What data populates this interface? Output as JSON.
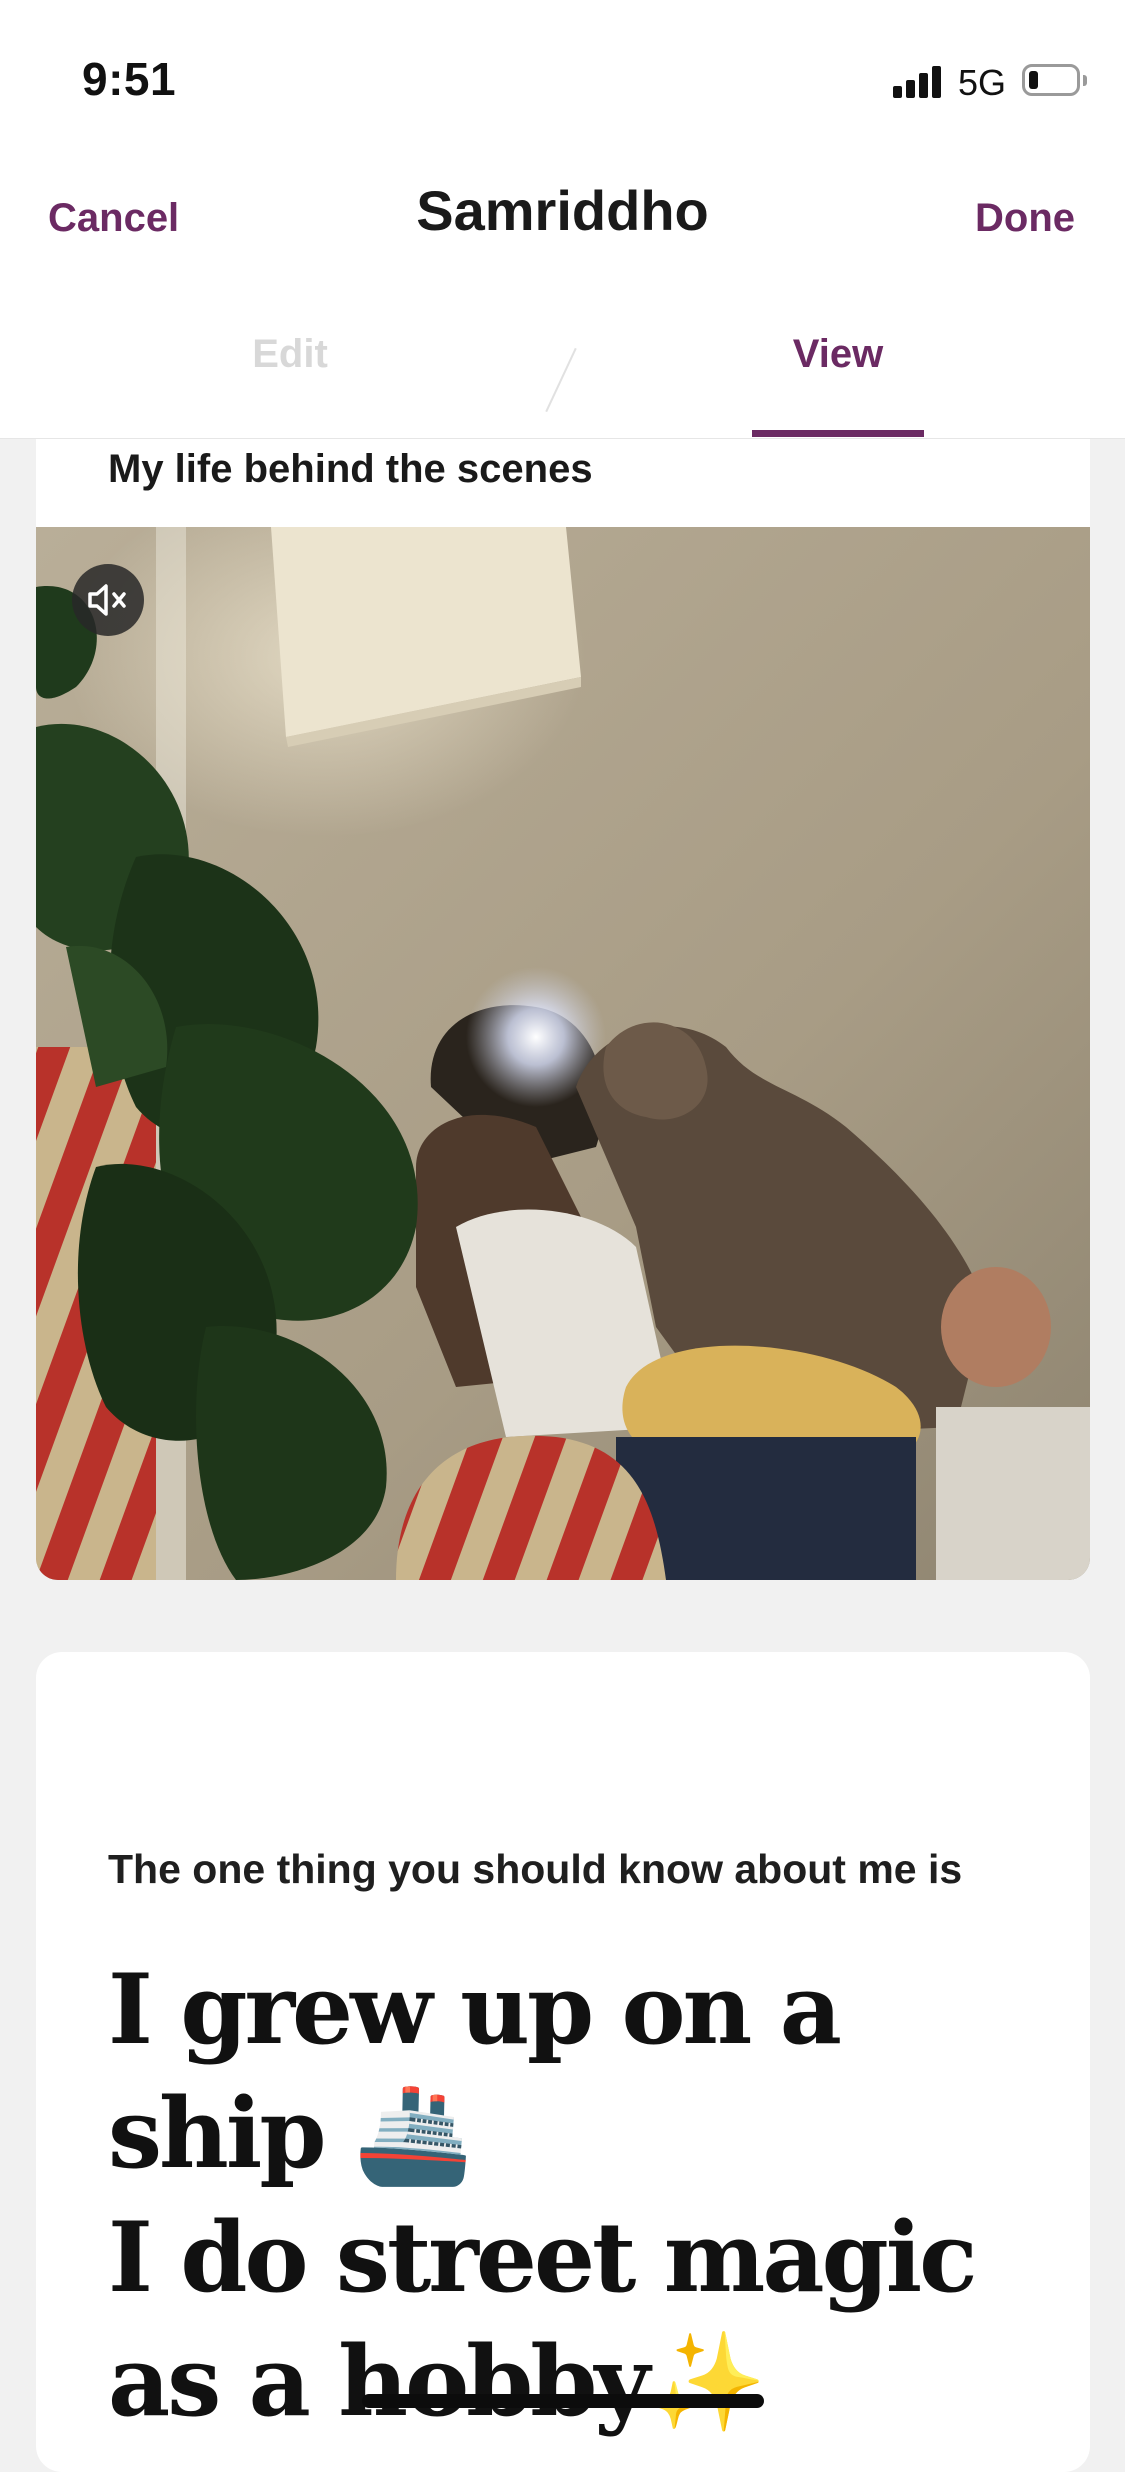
{
  "status_bar": {
    "time": "9:51",
    "network": "5G",
    "battery_level": 0.2
  },
  "nav": {
    "cancel_label": "Cancel",
    "title": "Samriddho",
    "done_label": "Done"
  },
  "tabs": [
    {
      "label": "Edit",
      "active": false
    },
    {
      "label": "View",
      "active": true
    }
  ],
  "video_card": {
    "title": "My life behind the scenes",
    "mute_icon": "speaker-muted-icon",
    "muted": true
  },
  "prompt_card": {
    "prompt": "The one thing you should know about me is",
    "answer": "I grew up on a ship 🚢\nI do street magic as a hobby✨"
  },
  "colors": {
    "accent": "#6b2a63",
    "background": "#f1f1f1",
    "card": "#ffffff"
  }
}
